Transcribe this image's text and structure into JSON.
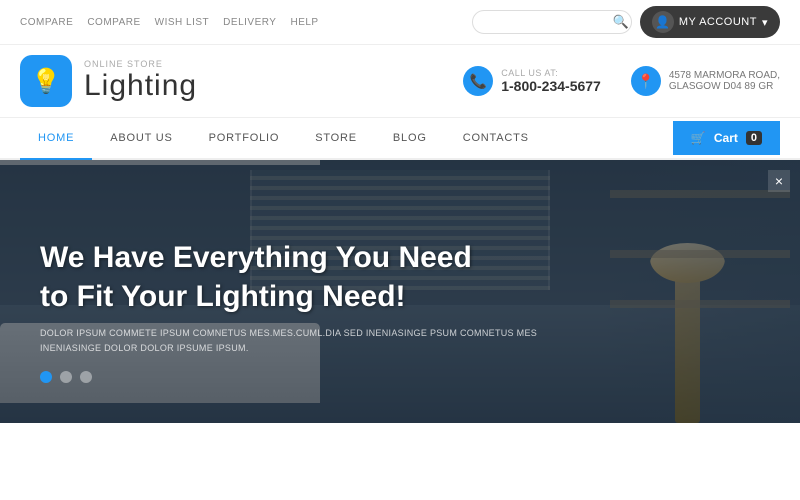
{
  "topbar": {
    "nav_items": [
      "COMPARE",
      "COMPARE",
      "WISH LIST",
      "DELIVERY",
      "HELP"
    ],
    "search_placeholder": "",
    "account_label": "MY ACCOUNT"
  },
  "header": {
    "brand": {
      "store_label": "ONLINE STORE",
      "name": "Lighting",
      "icon": "💡"
    },
    "phone": {
      "label": "CALL US AT:",
      "value": "1-800-234-5677"
    },
    "address": {
      "line1": "4578 MARMORA ROAD,",
      "line2": "GLASGOW D04 89 GR"
    }
  },
  "nav": {
    "items": [
      {
        "label": "HOME",
        "active": true
      },
      {
        "label": "ABOUT US",
        "active": false
      },
      {
        "label": "PORTFOLIO",
        "active": false
      },
      {
        "label": "STORE",
        "active": false
      },
      {
        "label": "BLOG",
        "active": false
      },
      {
        "label": "CONTACTS",
        "active": false
      }
    ],
    "cart_label": "Cart",
    "cart_count": "0"
  },
  "hero": {
    "title_line1": "We Have Everything You Need",
    "title_line2": "to Fit Your Lighting Need!",
    "subtitle": "DOLOR IPSUM COMMETE IPSUM COMNETUS MES.MES.CUML.DIA SED INENIASINGE PSUM COMNETUS MES INENIASINGE DOLOR DOLOR IPSUME IPSUM.",
    "dots": [
      "active",
      "inactive",
      "inactive"
    ]
  },
  "icons": {
    "search": "🔍",
    "user": "👤",
    "phone": "📞",
    "location": "📍",
    "cart": "🛒",
    "chevron": "▾",
    "light_bulb": "💡",
    "scroll": "×"
  }
}
